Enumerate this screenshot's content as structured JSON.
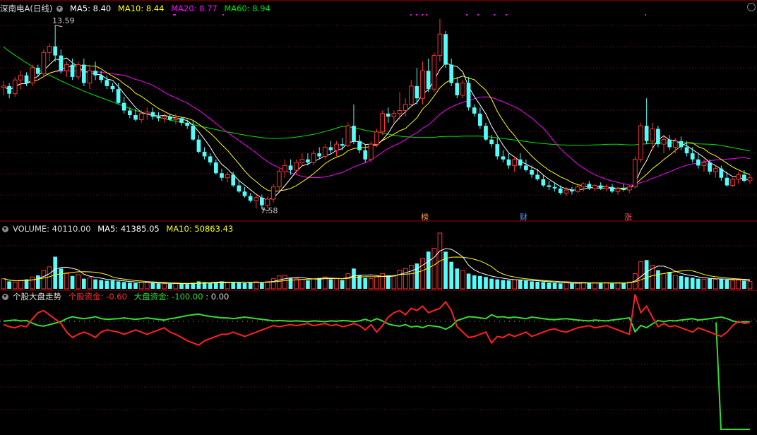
{
  "colors": {
    "up": "#ff3232",
    "down": "#54fcfc",
    "ma5": "#ffffff",
    "ma10": "#ffff00",
    "ma20": "#ff00ff",
    "ma60": "#00e600",
    "stock_fund": "#ff2020",
    "market_fund": "#33dd33",
    "grid": "#7a1010"
  },
  "price_panel": {
    "title": "深南电A(日线)",
    "ma5_label": "MA5: 8.40",
    "ma10_label": "MA10: 8.44",
    "ma20_label": "MA20: 8.77",
    "ma60_label": "MA60: 8.94",
    "high_label": "13.59",
    "low_label": "7.58",
    "event_tags": [
      {
        "text": "榜",
        "color": "#ff9933"
      },
      {
        "text": "财",
        "color": "#6699ff"
      },
      {
        "text": "涨",
        "color": "#ff5555"
      }
    ]
  },
  "volume_panel": {
    "title": "VOLUME: 40110.00",
    "ma5_label": "MA5: 41385.05",
    "ma10_label": "MA10: 50863.43"
  },
  "fund_panel": {
    "title": "个股大盘走势",
    "stock_label": "个股资金: -0.60",
    "market_label": "大盘资金: -100.00",
    "zero_label": ": 0.00"
  },
  "icons": {
    "collapse": "collapse-circle-icon",
    "maximize": "maximize-icon"
  },
  "chart_data": {
    "type": "candlestick",
    "title": "深南电A(日线)",
    "price_range": [
      7.3,
      14.0
    ],
    "max_price": 13.59,
    "min_price": 7.58,
    "candles": [
      [
        11.55,
        11.78,
        11.3,
        11.6
      ],
      [
        11.6,
        11.7,
        11.2,
        11.35
      ],
      [
        11.35,
        11.9,
        11.25,
        11.8
      ],
      [
        11.8,
        12.1,
        11.5,
        11.95
      ],
      [
        11.95,
        12.05,
        11.6,
        11.7
      ],
      [
        11.7,
        12.3,
        11.6,
        12.2
      ],
      [
        12.2,
        12.3,
        11.9,
        12.0
      ],
      [
        12.0,
        12.8,
        11.9,
        12.7
      ],
      [
        12.7,
        13.0,
        12.4,
        12.9
      ],
      [
        12.9,
        13.59,
        12.4,
        12.6
      ],
      [
        12.6,
        12.8,
        12.0,
        12.1
      ],
      [
        12.1,
        12.4,
        11.9,
        12.3
      ],
      [
        12.3,
        12.5,
        11.8,
        11.9
      ],
      [
        11.9,
        12.4,
        11.8,
        12.3
      ],
      [
        12.3,
        12.5,
        11.6,
        11.7
      ],
      [
        11.7,
        12.3,
        11.5,
        12.1
      ],
      [
        12.1,
        12.4,
        11.8,
        11.95
      ],
      [
        11.95,
        12.1,
        11.7,
        11.8
      ],
      [
        11.8,
        11.95,
        11.5,
        11.6
      ],
      [
        11.6,
        11.7,
        11.4,
        11.5
      ],
      [
        11.5,
        11.7,
        11.0,
        11.05
      ],
      [
        11.05,
        11.25,
        10.7,
        10.8
      ],
      [
        10.8,
        10.9,
        10.55,
        10.65
      ],
      [
        10.65,
        10.85,
        10.45,
        10.5
      ],
      [
        10.5,
        10.8,
        10.4,
        10.7
      ],
      [
        10.7,
        10.9,
        10.5,
        10.75
      ],
      [
        10.75,
        10.9,
        10.5,
        10.6
      ],
      [
        10.6,
        10.75,
        10.45,
        10.55
      ],
      [
        10.55,
        10.7,
        10.4,
        10.6
      ],
      [
        10.6,
        10.7,
        10.45,
        10.5
      ],
      [
        10.5,
        10.7,
        10.35,
        10.55
      ],
      [
        10.55,
        10.6,
        10.3,
        10.4
      ],
      [
        10.4,
        10.5,
        10.2,
        10.3
      ],
      [
        10.3,
        10.45,
        9.8,
        9.85
      ],
      [
        9.85,
        10.0,
        9.4,
        9.45
      ],
      [
        9.45,
        9.6,
        9.2,
        9.3
      ],
      [
        9.3,
        9.4,
        9.0,
        9.1
      ],
      [
        9.1,
        9.2,
        8.7,
        8.75
      ],
      [
        8.75,
        8.9,
        8.5,
        8.6
      ],
      [
        8.6,
        8.8,
        8.45,
        8.7
      ],
      [
        8.7,
        8.8,
        8.3,
        8.35
      ],
      [
        8.35,
        8.5,
        8.1,
        8.15
      ],
      [
        8.15,
        8.3,
        7.95,
        8.0
      ],
      [
        8.0,
        8.1,
        7.8,
        7.85
      ],
      [
        7.85,
        8.1,
        7.6,
        7.95
      ],
      [
        7.95,
        8.05,
        7.58,
        7.7
      ],
      [
        7.7,
        8.0,
        7.6,
        7.9
      ],
      [
        7.9,
        8.4,
        7.8,
        8.3
      ],
      [
        8.3,
        8.9,
        8.2,
        8.8
      ],
      [
        8.8,
        9.2,
        8.6,
        9.0
      ],
      [
        9.0,
        9.2,
        8.7,
        8.85
      ],
      [
        8.85,
        9.2,
        8.7,
        9.1
      ],
      [
        9.1,
        9.4,
        9.0,
        9.2
      ],
      [
        9.2,
        9.4,
        9.0,
        9.1
      ],
      [
        9.1,
        9.5,
        9.0,
        9.4
      ],
      [
        9.4,
        9.6,
        9.2,
        9.3
      ],
      [
        9.3,
        9.7,
        9.2,
        9.6
      ],
      [
        9.6,
        9.8,
        9.4,
        9.5
      ],
      [
        9.5,
        9.8,
        9.3,
        9.7
      ],
      [
        9.7,
        9.9,
        9.5,
        9.65
      ],
      [
        9.65,
        10.4,
        9.6,
        10.3
      ],
      [
        10.3,
        11.0,
        9.7,
        9.8
      ],
      [
        9.8,
        10.0,
        9.4,
        9.5
      ],
      [
        9.5,
        9.7,
        9.1,
        9.2
      ],
      [
        9.2,
        9.8,
        9.1,
        9.7
      ],
      [
        9.7,
        10.2,
        9.6,
        10.1
      ],
      [
        10.1,
        10.8,
        10.0,
        10.7
      ],
      [
        10.7,
        10.9,
        10.4,
        10.6
      ],
      [
        10.6,
        10.8,
        10.4,
        10.7
      ],
      [
        10.7,
        11.4,
        10.5,
        10.8
      ],
      [
        10.8,
        11.2,
        10.6,
        11.0
      ],
      [
        11.0,
        11.8,
        10.9,
        11.6
      ],
      [
        11.6,
        12.2,
        11.0,
        11.2
      ],
      [
        11.2,
        12.4,
        11.0,
        12.1
      ],
      [
        12.1,
        12.5,
        11.4,
        11.5
      ],
      [
        11.5,
        12.7,
        11.4,
        12.6
      ],
      [
        12.6,
        13.8,
        12.4,
        13.3
      ],
      [
        13.3,
        13.4,
        12.2,
        12.3
      ],
      [
        12.3,
        12.5,
        11.6,
        11.7
      ],
      [
        11.7,
        11.9,
        11.2,
        11.3
      ],
      [
        11.3,
        11.8,
        11.2,
        11.7
      ],
      [
        11.7,
        11.9,
        10.8,
        10.9
      ],
      [
        10.9,
        11.0,
        10.6,
        10.7
      ],
      [
        10.7,
        10.9,
        10.2,
        10.3
      ],
      [
        10.3,
        10.4,
        9.8,
        9.85
      ],
      [
        9.85,
        10.0,
        9.6,
        9.7
      ],
      [
        9.7,
        9.9,
        9.2,
        9.3
      ],
      [
        9.3,
        9.5,
        9.1,
        9.2
      ],
      [
        9.2,
        9.4,
        8.9,
        9.0
      ],
      [
        9.0,
        9.3,
        8.8,
        9.2
      ],
      [
        9.2,
        9.4,
        8.9,
        9.0
      ],
      [
        9.0,
        9.2,
        8.8,
        8.85
      ],
      [
        8.85,
        9.0,
        8.6,
        8.7
      ],
      [
        8.7,
        8.9,
        8.5,
        8.55
      ],
      [
        8.55,
        8.7,
        8.3,
        8.35
      ],
      [
        8.35,
        8.5,
        8.2,
        8.3
      ],
      [
        8.3,
        8.45,
        8.15,
        8.25
      ],
      [
        8.25,
        8.35,
        8.05,
        8.1
      ],
      [
        8.1,
        8.3,
        8.0,
        8.2
      ],
      [
        8.2,
        8.3,
        8.05,
        8.15
      ],
      [
        8.15,
        8.35,
        8.1,
        8.3
      ],
      [
        8.3,
        8.45,
        8.15,
        8.4
      ],
      [
        8.4,
        8.5,
        8.2,
        8.25
      ],
      [
        8.25,
        8.4,
        8.15,
        8.35
      ],
      [
        8.35,
        8.45,
        8.2,
        8.25
      ],
      [
        8.25,
        8.4,
        8.15,
        8.3
      ],
      [
        8.3,
        8.4,
        8.1,
        8.15
      ],
      [
        8.15,
        8.3,
        8.05,
        8.25
      ],
      [
        8.25,
        8.4,
        8.15,
        8.2
      ],
      [
        8.2,
        8.35,
        8.1,
        8.3
      ],
      [
        8.3,
        9.3,
        8.25,
        9.2
      ],
      [
        9.2,
        10.4,
        9.1,
        10.3
      ],
      [
        10.3,
        11.2,
        9.7,
        9.8
      ],
      [
        9.8,
        10.4,
        9.5,
        10.2
      ],
      [
        10.2,
        10.3,
        9.6,
        9.7
      ],
      [
        9.7,
        10.0,
        9.4,
        9.85
      ],
      [
        9.85,
        10.0,
        9.5,
        9.6
      ],
      [
        9.6,
        9.9,
        9.4,
        9.8
      ],
      [
        9.8,
        9.95,
        9.5,
        9.6
      ],
      [
        9.6,
        9.8,
        9.3,
        9.4
      ],
      [
        9.4,
        9.6,
        9.1,
        9.2
      ],
      [
        9.2,
        9.4,
        8.9,
        9.0
      ],
      [
        9.0,
        9.2,
        8.8,
        9.1
      ],
      [
        9.1,
        9.2,
        8.7,
        8.8
      ],
      [
        8.8,
        9.0,
        8.6,
        8.9
      ],
      [
        8.9,
        9.0,
        8.5,
        8.6
      ],
      [
        8.6,
        8.8,
        8.3,
        8.35
      ],
      [
        8.35,
        8.6,
        8.3,
        8.55
      ],
      [
        8.55,
        8.8,
        8.4,
        8.7
      ],
      [
        8.7,
        8.85,
        8.45,
        8.5
      ],
      [
        8.5,
        8.7,
        8.4,
        8.6
      ]
    ],
    "volume": [
      30,
      22,
      20,
      25,
      28,
      35,
      40,
      55,
      65,
      95,
      60,
      45,
      38,
      42,
      30,
      32,
      28,
      26,
      24,
      25,
      22,
      20,
      18,
      17,
      19,
      18,
      17,
      16,
      15,
      15,
      16,
      15,
      14,
      18,
      22,
      20,
      18,
      20,
      22,
      18,
      20,
      18,
      17,
      19,
      21,
      18,
      22,
      30,
      38,
      40,
      32,
      30,
      28,
      25,
      30,
      32,
      35,
      28,
      30,
      26,
      45,
      60,
      40,
      32,
      30,
      35,
      45,
      40,
      38,
      55,
      60,
      70,
      75,
      90,
      110,
      120,
      165,
      110,
      80,
      60,
      55,
      45,
      40,
      38,
      35,
      30,
      28,
      26,
      25,
      27,
      26,
      24,
      22,
      21,
      20,
      18,
      17,
      16,
      18,
      16,
      17,
      19,
      18,
      17,
      18,
      17,
      16,
      18,
      17,
      20,
      45,
      80,
      85,
      70,
      55,
      45,
      50,
      40,
      38,
      35,
      33,
      30,
      28,
      30,
      28,
      30,
      27,
      25,
      26,
      24,
      22
    ],
    "stock_fund": [
      -3,
      -5,
      -6,
      -4,
      -5,
      2,
      8,
      10,
      6,
      2,
      -2,
      -10,
      -15,
      -12,
      -10,
      -12,
      -15,
      -10,
      -8,
      -9,
      -10,
      -12,
      -10,
      -8,
      -10,
      -12,
      -10,
      -8,
      -6,
      -10,
      -12,
      -15,
      -18,
      -20,
      -22,
      -18,
      -16,
      -14,
      -12,
      -12,
      -10,
      -12,
      -14,
      -12,
      -10,
      -8,
      -6,
      -4,
      -5,
      -4,
      -3,
      -4,
      -3,
      -2,
      -4,
      -3,
      -2,
      -4,
      -3,
      -5,
      -4,
      -2,
      -4,
      -8,
      -3,
      -10,
      -4,
      4,
      8,
      10,
      6,
      12,
      10,
      14,
      8,
      10,
      12,
      18,
      10,
      -5,
      -10,
      -15,
      -14,
      -12,
      -10,
      -20,
      -14,
      -15,
      -12,
      -14,
      -12,
      -10,
      -14,
      -12,
      -10,
      -8,
      -7,
      -9,
      -10,
      -8,
      -6,
      -5,
      -4,
      -6,
      -5,
      -4,
      -6,
      -8,
      -10,
      -12,
      25,
      8,
      14,
      4,
      -5,
      -2,
      -5,
      -4,
      -6,
      -8,
      -10,
      -6,
      -8,
      -10,
      -12,
      -14,
      -10,
      -4,
      0,
      -2,
      -1
    ],
    "market_fund_tail": [
      -100,
      -100,
      -100,
      -100,
      -100,
      -100,
      -100,
      -100,
      -100,
      -100
    ]
  }
}
